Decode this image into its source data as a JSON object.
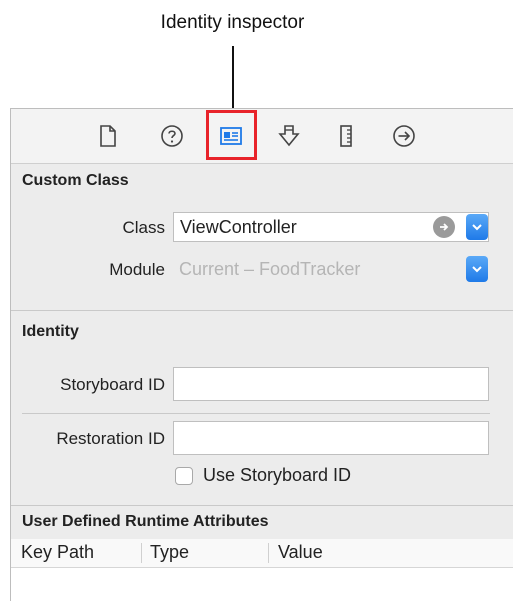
{
  "callout": {
    "label": "Identity inspector"
  },
  "toolbar": {
    "icons": [
      "file-icon",
      "help-icon",
      "identity-icon",
      "attributes-icon",
      "size-icon",
      "connections-icon"
    ],
    "selected": "identity-icon",
    "accent": "#1f7ae8",
    "highlight_color": "#e8232a"
  },
  "custom_class": {
    "title": "Custom Class",
    "class_label": "Class",
    "class_value": "ViewController",
    "module_label": "Module",
    "module_placeholder": "Current – FoodTracker"
  },
  "identity": {
    "title": "Identity",
    "storyboard_id_label": "Storyboard ID",
    "storyboard_id_value": "",
    "restoration_id_label": "Restoration ID",
    "restoration_id_value": "",
    "use_storyboard_id_label": "Use Storyboard ID",
    "use_storyboard_id_checked": false
  },
  "runtime_attributes": {
    "title": "User Defined Runtime Attributes",
    "columns": [
      "Key Path",
      "Type",
      "Value"
    ]
  }
}
